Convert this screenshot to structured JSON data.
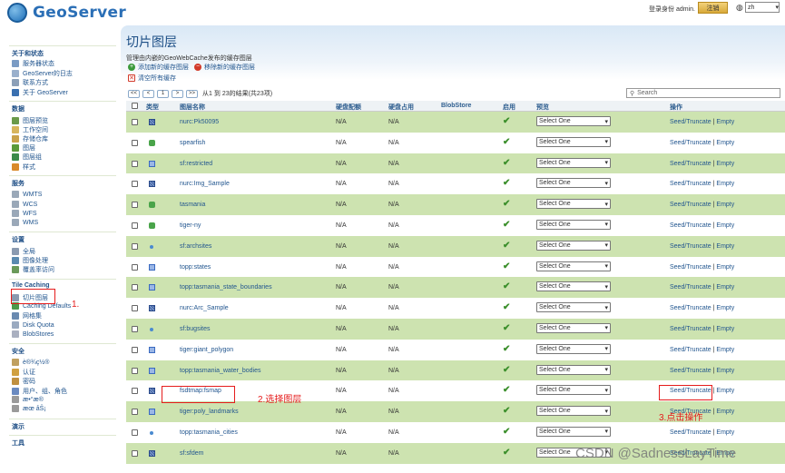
{
  "header": {
    "logo_text": "GeoServer",
    "login_text": "登录身份 admin.",
    "logout_label": "注销",
    "lang_value": "zh"
  },
  "sidebar": {
    "sections": [
      {
        "title": "关于和状态",
        "items": [
          {
            "label": "服务器状态",
            "icon": "server-icon",
            "color": "#7a9bc4"
          },
          {
            "label": "GeoServer的日志",
            "icon": "log-icon",
            "color": "#9ab0cc"
          },
          {
            "label": "联系方式",
            "icon": "contact-icon",
            "color": "#8ca0b8"
          },
          {
            "label": "关于 GeoServer",
            "icon": "info-icon",
            "color": "#3a70b0"
          }
        ]
      },
      {
        "title": "数据",
        "items": [
          {
            "label": "图层预览",
            "icon": "preview-icon",
            "color": "#6a9a4a"
          },
          {
            "label": "工作空间",
            "icon": "workspace-icon",
            "color": "#d7b55c"
          },
          {
            "label": "存储仓库",
            "icon": "store-icon",
            "color": "#c9a24a"
          },
          {
            "label": "图层",
            "icon": "layer-icon",
            "color": "#5a9a3a"
          },
          {
            "label": "图层组",
            "icon": "layergroup-icon",
            "color": "#3a8a4a"
          },
          {
            "label": "样式",
            "icon": "style-icon",
            "color": "#d98a2a"
          }
        ]
      },
      {
        "title": "服务",
        "items": [
          {
            "label": "WMTS",
            "icon": "wmts-icon",
            "color": "#9aa8b8"
          },
          {
            "label": "WCS",
            "icon": "wcs-icon",
            "color": "#9aa8b8"
          },
          {
            "label": "WFS",
            "icon": "wfs-icon",
            "color": "#9aa8b8"
          },
          {
            "label": "WMS",
            "icon": "wms-icon",
            "color": "#9aa8b8"
          }
        ]
      },
      {
        "title": "设置",
        "items": [
          {
            "label": "全局",
            "icon": "global-icon",
            "color": "#8a9ab0"
          },
          {
            "label": "图像处理",
            "icon": "image-icon",
            "color": "#5a8ab0"
          },
          {
            "label": "覆盖率访问",
            "icon": "coverage-icon",
            "color": "#6a9a5a"
          }
        ]
      },
      {
        "title": "Tile Caching",
        "items": [
          {
            "label": "切片图层",
            "icon": "tile-layers-icon",
            "color": "#8a9ab0"
          },
          {
            "label": "Caching Defaults",
            "icon": "caching-icon",
            "color": "#4a9a4a"
          },
          {
            "label": "网格集",
            "icon": "gridset-icon",
            "color": "#6a8ab0"
          },
          {
            "label": "Disk Quota",
            "icon": "disk-icon",
            "color": "#9aaac0"
          },
          {
            "label": "BlobStores",
            "icon": "blobstore-icon",
            "color": "#aab0c0"
          }
        ]
      },
      {
        "title": "安全",
        "items": [
          {
            "label": "è®¾ç½®",
            "icon": "settings-key-icon",
            "color": "#c0a060"
          },
          {
            "label": "认证",
            "icon": "auth-icon",
            "color": "#d0a040"
          },
          {
            "label": "密码",
            "icon": "password-icon",
            "color": "#c09040"
          },
          {
            "label": "用户、组、角色",
            "icon": "users-icon",
            "color": "#6a8ac0"
          },
          {
            "label": "æ•°æ®",
            "icon": "data-security-icon",
            "color": "#9a9a9a"
          },
          {
            "label": "æœ åŠ¡",
            "icon": "service-security-icon",
            "color": "#9a9a9a"
          }
        ]
      },
      {
        "title": "演示",
        "items": []
      },
      {
        "title": "工具",
        "items": []
      }
    ]
  },
  "main": {
    "title": "切片图层",
    "description": "管理由内嵌的GeoWebCache发布的缓存图层",
    "actions": {
      "add": "添加新的缓存图层",
      "remove": "移除新的缓存图层",
      "clear": "清空所有缓存"
    },
    "pager": {
      "first": "<<",
      "prev": "<",
      "page": "1",
      "next": ">",
      "last": ">>",
      "info": "从1 到 23的结果(共23项)"
    },
    "search_placeholder": "Search",
    "columns": {
      "type": "类型",
      "name": "图层名称",
      "disk_quota": "硬盘配额",
      "disk_used": "硬盘占用",
      "blobstore": "BlobStore",
      "enabled": "启用",
      "preview": "预览",
      "actions": "操作"
    },
    "rows": [
      {
        "name": "nurc:Pk50095",
        "type": "raster",
        "quota": "N/A",
        "used": "N/A",
        "preview": "Select One"
      },
      {
        "name": "spearfish",
        "type": "group",
        "quota": "N/A",
        "used": "N/A",
        "preview": "Select One"
      },
      {
        "name": "sf:restricted",
        "type": "polygon",
        "quota": "N/A",
        "used": "N/A",
        "preview": "Select One"
      },
      {
        "name": "nurc:Img_Sample",
        "type": "raster",
        "quota": "N/A",
        "used": "N/A",
        "preview": "Select One"
      },
      {
        "name": "tasmania",
        "type": "group",
        "quota": "N/A",
        "used": "N/A",
        "preview": "Select One"
      },
      {
        "name": "tiger-ny",
        "type": "group",
        "quota": "N/A",
        "used": "N/A",
        "preview": "Select One"
      },
      {
        "name": "sf:archsites",
        "type": "point",
        "quota": "N/A",
        "used": "N/A",
        "preview": "Select One"
      },
      {
        "name": "topp:states",
        "type": "polygon",
        "quota": "N/A",
        "used": "N/A",
        "preview": "Select One"
      },
      {
        "name": "topp:tasmania_state_boundaries",
        "type": "polygon",
        "quota": "N/A",
        "used": "N/A",
        "preview": "Select One"
      },
      {
        "name": "nurc:Arc_Sample",
        "type": "raster",
        "quota": "N/A",
        "used": "N/A",
        "preview": "Select One"
      },
      {
        "name": "sf:bugsites",
        "type": "point",
        "quota": "N/A",
        "used": "N/A",
        "preview": "Select One"
      },
      {
        "name": "tiger:giant_polygon",
        "type": "polygon",
        "quota": "N/A",
        "used": "N/A",
        "preview": "Select One"
      },
      {
        "name": "topp:tasmania_water_bodies",
        "type": "polygon",
        "quota": "N/A",
        "used": "N/A",
        "preview": "Select One"
      },
      {
        "name": "fsdtmap:fsmap",
        "type": "raster",
        "quota": "N/A",
        "used": "N/A",
        "preview": "Select One"
      },
      {
        "name": "tiger:poly_landmarks",
        "type": "polygon",
        "quota": "N/A",
        "used": "N/A",
        "preview": "Select One"
      },
      {
        "name": "topp:tasmania_cities",
        "type": "point",
        "quota": "N/A",
        "used": "N/A",
        "preview": "Select One"
      },
      {
        "name": "sf:sfdem",
        "type": "raster",
        "quota": "N/A",
        "used": "N/A",
        "preview": "Select One"
      }
    ],
    "seed_label": "Seed/Truncate",
    "empty_label": "Empty",
    "separator": "|"
  },
  "annotations": {
    "step1": "1.",
    "step2": "2.选择图层",
    "step3": "3.点击操作"
  },
  "watermark": "CSDN @SadnessLayTime",
  "colors": {
    "accent": "#1d4f86",
    "row_alt": "#cde3b0",
    "annotation": "#e51c1c"
  }
}
